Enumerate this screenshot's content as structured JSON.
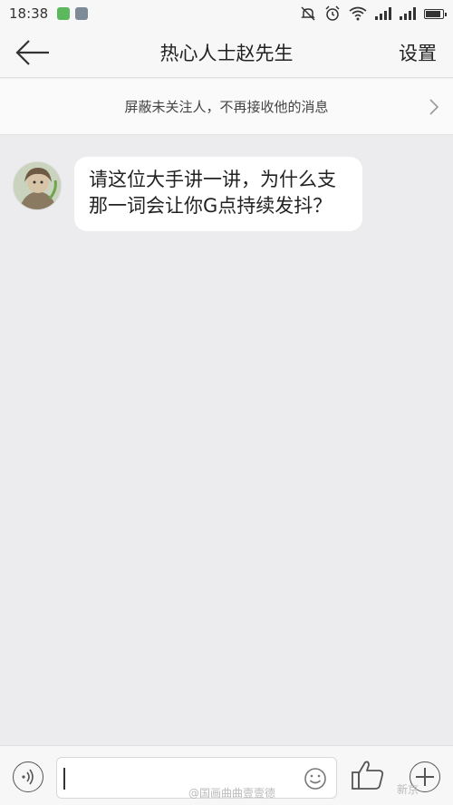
{
  "status_bar": {
    "time": "18:38",
    "app_icons": [
      "app-green-icon",
      "app-gray-icon"
    ],
    "indicators": [
      "mute-icon",
      "alarm-icon",
      "wifi-icon",
      "signal-icon",
      "signal-icon",
      "battery-icon"
    ]
  },
  "header": {
    "back_icon": "back-arrow-icon",
    "title": "热心人士赵先生",
    "settings_label": "设置"
  },
  "notice": {
    "text": "屏蔽未关注人，不再接收他的消息",
    "arrow_icon": "chevron-right-icon"
  },
  "conversation": {
    "messages": [
      {
        "avatar_icon": "user-avatar",
        "text": "请这位大手讲一讲，为什么支那一词会让你G点持续发抖？"
      }
    ]
  },
  "input_bar": {
    "voice_icon": "voice-icon",
    "input_value": "",
    "emoji_icon": "emoji-icon",
    "like_icon": "thumbs-up-icon",
    "add_icon": "plus-icon"
  },
  "watermark": {
    "text": "@国画曲曲壹壹德",
    "corner_text": "新京"
  },
  "colors": {
    "background": "#ececee",
    "bar": "#f7f7f7",
    "bubble": "#ffffff"
  }
}
